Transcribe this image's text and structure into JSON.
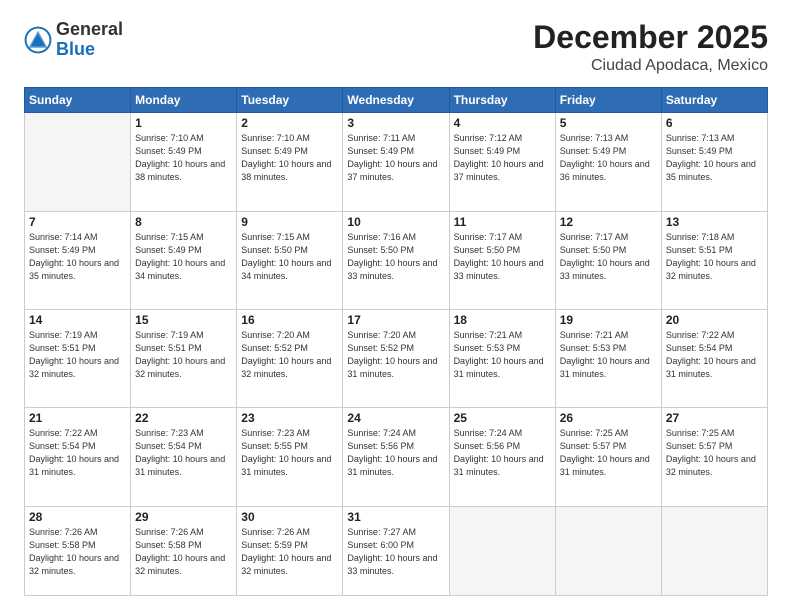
{
  "header": {
    "logo_general": "General",
    "logo_blue": "Blue",
    "month_year": "December 2025",
    "location": "Ciudad Apodaca, Mexico"
  },
  "days_of_week": [
    "Sunday",
    "Monday",
    "Tuesday",
    "Wednesday",
    "Thursday",
    "Friday",
    "Saturday"
  ],
  "weeks": [
    [
      {
        "num": "",
        "detail": ""
      },
      {
        "num": "1",
        "detail": "Sunrise: 7:10 AM\nSunset: 5:49 PM\nDaylight: 10 hours\nand 38 minutes."
      },
      {
        "num": "2",
        "detail": "Sunrise: 7:10 AM\nSunset: 5:49 PM\nDaylight: 10 hours\nand 38 minutes."
      },
      {
        "num": "3",
        "detail": "Sunrise: 7:11 AM\nSunset: 5:49 PM\nDaylight: 10 hours\nand 37 minutes."
      },
      {
        "num": "4",
        "detail": "Sunrise: 7:12 AM\nSunset: 5:49 PM\nDaylight: 10 hours\nand 37 minutes."
      },
      {
        "num": "5",
        "detail": "Sunrise: 7:13 AM\nSunset: 5:49 PM\nDaylight: 10 hours\nand 36 minutes."
      },
      {
        "num": "6",
        "detail": "Sunrise: 7:13 AM\nSunset: 5:49 PM\nDaylight: 10 hours\nand 35 minutes."
      }
    ],
    [
      {
        "num": "7",
        "detail": "Sunrise: 7:14 AM\nSunset: 5:49 PM\nDaylight: 10 hours\nand 35 minutes."
      },
      {
        "num": "8",
        "detail": "Sunrise: 7:15 AM\nSunset: 5:49 PM\nDaylight: 10 hours\nand 34 minutes."
      },
      {
        "num": "9",
        "detail": "Sunrise: 7:15 AM\nSunset: 5:50 PM\nDaylight: 10 hours\nand 34 minutes."
      },
      {
        "num": "10",
        "detail": "Sunrise: 7:16 AM\nSunset: 5:50 PM\nDaylight: 10 hours\nand 33 minutes."
      },
      {
        "num": "11",
        "detail": "Sunrise: 7:17 AM\nSunset: 5:50 PM\nDaylight: 10 hours\nand 33 minutes."
      },
      {
        "num": "12",
        "detail": "Sunrise: 7:17 AM\nSunset: 5:50 PM\nDaylight: 10 hours\nand 33 minutes."
      },
      {
        "num": "13",
        "detail": "Sunrise: 7:18 AM\nSunset: 5:51 PM\nDaylight: 10 hours\nand 32 minutes."
      }
    ],
    [
      {
        "num": "14",
        "detail": "Sunrise: 7:19 AM\nSunset: 5:51 PM\nDaylight: 10 hours\nand 32 minutes."
      },
      {
        "num": "15",
        "detail": "Sunrise: 7:19 AM\nSunset: 5:51 PM\nDaylight: 10 hours\nand 32 minutes."
      },
      {
        "num": "16",
        "detail": "Sunrise: 7:20 AM\nSunset: 5:52 PM\nDaylight: 10 hours\nand 32 minutes."
      },
      {
        "num": "17",
        "detail": "Sunrise: 7:20 AM\nSunset: 5:52 PM\nDaylight: 10 hours\nand 31 minutes."
      },
      {
        "num": "18",
        "detail": "Sunrise: 7:21 AM\nSunset: 5:53 PM\nDaylight: 10 hours\nand 31 minutes."
      },
      {
        "num": "19",
        "detail": "Sunrise: 7:21 AM\nSunset: 5:53 PM\nDaylight: 10 hours\nand 31 minutes."
      },
      {
        "num": "20",
        "detail": "Sunrise: 7:22 AM\nSunset: 5:54 PM\nDaylight: 10 hours\nand 31 minutes."
      }
    ],
    [
      {
        "num": "21",
        "detail": "Sunrise: 7:22 AM\nSunset: 5:54 PM\nDaylight: 10 hours\nand 31 minutes."
      },
      {
        "num": "22",
        "detail": "Sunrise: 7:23 AM\nSunset: 5:54 PM\nDaylight: 10 hours\nand 31 minutes."
      },
      {
        "num": "23",
        "detail": "Sunrise: 7:23 AM\nSunset: 5:55 PM\nDaylight: 10 hours\nand 31 minutes."
      },
      {
        "num": "24",
        "detail": "Sunrise: 7:24 AM\nSunset: 5:56 PM\nDaylight: 10 hours\nand 31 minutes."
      },
      {
        "num": "25",
        "detail": "Sunrise: 7:24 AM\nSunset: 5:56 PM\nDaylight: 10 hours\nand 31 minutes."
      },
      {
        "num": "26",
        "detail": "Sunrise: 7:25 AM\nSunset: 5:57 PM\nDaylight: 10 hours\nand 31 minutes."
      },
      {
        "num": "27",
        "detail": "Sunrise: 7:25 AM\nSunset: 5:57 PM\nDaylight: 10 hours\nand 32 minutes."
      }
    ],
    [
      {
        "num": "28",
        "detail": "Sunrise: 7:26 AM\nSunset: 5:58 PM\nDaylight: 10 hours\nand 32 minutes."
      },
      {
        "num": "29",
        "detail": "Sunrise: 7:26 AM\nSunset: 5:58 PM\nDaylight: 10 hours\nand 32 minutes."
      },
      {
        "num": "30",
        "detail": "Sunrise: 7:26 AM\nSunset: 5:59 PM\nDaylight: 10 hours\nand 32 minutes."
      },
      {
        "num": "31",
        "detail": "Sunrise: 7:27 AM\nSunset: 6:00 PM\nDaylight: 10 hours\nand 33 minutes."
      },
      {
        "num": "",
        "detail": ""
      },
      {
        "num": "",
        "detail": ""
      },
      {
        "num": "",
        "detail": ""
      }
    ]
  ]
}
